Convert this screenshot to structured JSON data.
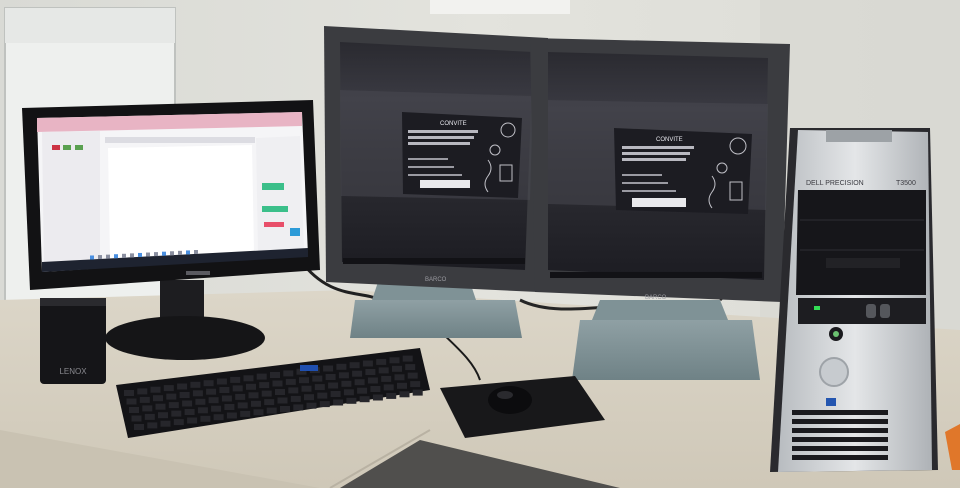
{
  "left_monitor": {
    "brand": "",
    "taskbar_icon_count": 14
  },
  "center_monitors": {
    "brand": "BARCO",
    "invite_title": "CONVITE",
    "invite_lines_visible": false
  },
  "workstation": {
    "model": "DELL PRECISION",
    "series": "T3500"
  },
  "speaker": {
    "brand": "LENOX"
  },
  "mousepad": {
    "brand": ""
  }
}
